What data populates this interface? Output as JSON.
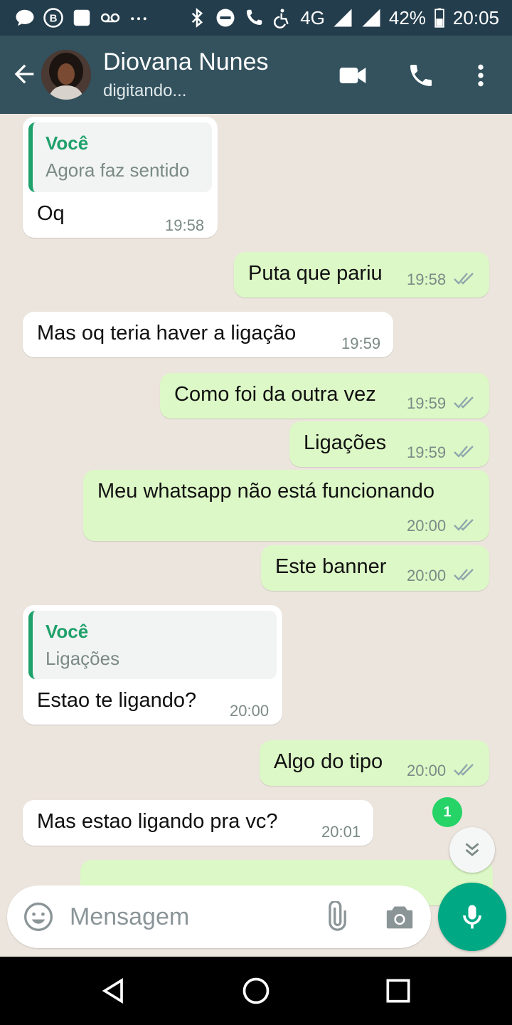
{
  "status_bar": {
    "network": "4G",
    "battery": "42%",
    "time": "20:05"
  },
  "header": {
    "contact_name": "Diovana Nunes",
    "contact_status": "digitando..."
  },
  "messages": [
    {
      "dir": "in",
      "quote_author": "Você",
      "quote_text": "Agora faz sentido",
      "text": "Oq",
      "time": "19:58"
    },
    {
      "dir": "out",
      "text": "Puta que pariu",
      "time": "19:58"
    },
    {
      "dir": "in",
      "text": "Mas oq teria haver a ligação",
      "time": "19:59"
    },
    {
      "dir": "out",
      "text": "Como foi da outra vez",
      "time": "19:59"
    },
    {
      "dir": "out",
      "text": "Ligações",
      "time": "19:59"
    },
    {
      "dir": "out",
      "text": "Meu whatsapp não está funcionando",
      "time": "20:00"
    },
    {
      "dir": "out",
      "text": "Este banner",
      "time": "20:00"
    },
    {
      "dir": "in",
      "quote_author": "Você",
      "quote_text": "Ligações",
      "text": "Estao te ligando?",
      "time": "20:00"
    },
    {
      "dir": "out",
      "text": "Algo do tipo",
      "time": "20:00"
    },
    {
      "dir": "in",
      "text": "Mas estao ligando pra vc?",
      "time": "20:01"
    }
  ],
  "unread_count": "1",
  "composer": {
    "placeholder": "Mensagem"
  },
  "colors": {
    "header": "#33525e",
    "status_bar": "#233d4c",
    "outgoing_bubble": "#dcf8c6",
    "incoming_bubble": "#ffffff",
    "accent": "#00a884",
    "quote_author": "#1fa16b"
  }
}
